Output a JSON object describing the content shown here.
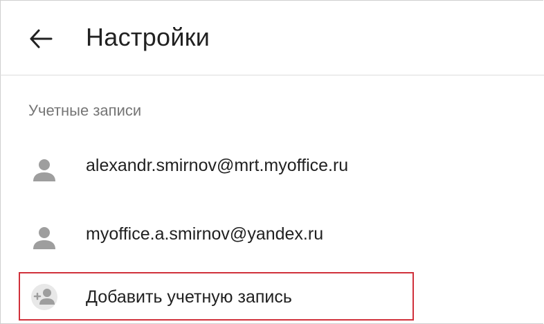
{
  "header": {
    "back_icon": "arrow-left-icon",
    "title": "Настройки"
  },
  "accounts": {
    "section_label": "Учетные записи",
    "items": [
      {
        "email": "alexandr.smirnov@mrt.myoffice.ru",
        "icon": "person-icon"
      },
      {
        "email": "myoffice.a.smirnov@yandex.ru",
        "icon": "person-icon"
      }
    ],
    "add_account": {
      "label": "Добавить учетную запись",
      "icon": "add-person-icon"
    }
  },
  "colors": {
    "highlight_border": "#d0303a",
    "icon_gray": "#9e9e9e",
    "text_primary": "#212121",
    "text_secondary": "#757575"
  }
}
